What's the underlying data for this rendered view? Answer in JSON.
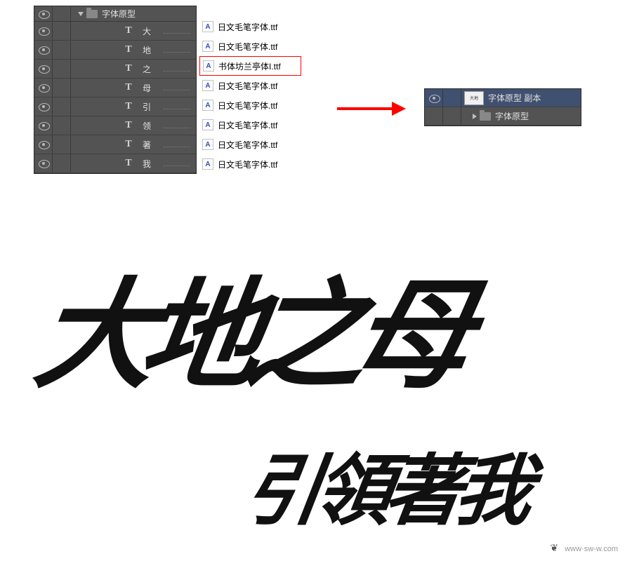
{
  "layersLeft": {
    "groupName": "字体原型",
    "items": [
      {
        "label": "大"
      },
      {
        "label": "地"
      },
      {
        "label": "之"
      },
      {
        "label": "母"
      },
      {
        "label": "引"
      },
      {
        "label": "领"
      },
      {
        "label": "著"
      },
      {
        "label": "我"
      }
    ]
  },
  "fontFiles": [
    {
      "name": "日文毛笔字体.ttf",
      "highlighted": false
    },
    {
      "name": "日文毛笔字体.ttf",
      "highlighted": false
    },
    {
      "name": "书体坊兰亭体I.ttf",
      "highlighted": true
    },
    {
      "name": "日文毛笔字体.ttf",
      "highlighted": false
    },
    {
      "name": "日文毛笔字体.ttf",
      "highlighted": false
    },
    {
      "name": "日文毛笔字体.ttf",
      "highlighted": false
    },
    {
      "name": "日文毛笔字体.ttf",
      "highlighted": false
    },
    {
      "name": "日文毛笔字体.ttf",
      "highlighted": false
    }
  ],
  "layersRight": {
    "smartObjectLabel": "字体原型 副本",
    "groupLabel": "字体原型"
  },
  "calligraphy": {
    "main": "大地之母",
    "sub": "引領著我"
  },
  "watermark": "www·sw-w.com"
}
